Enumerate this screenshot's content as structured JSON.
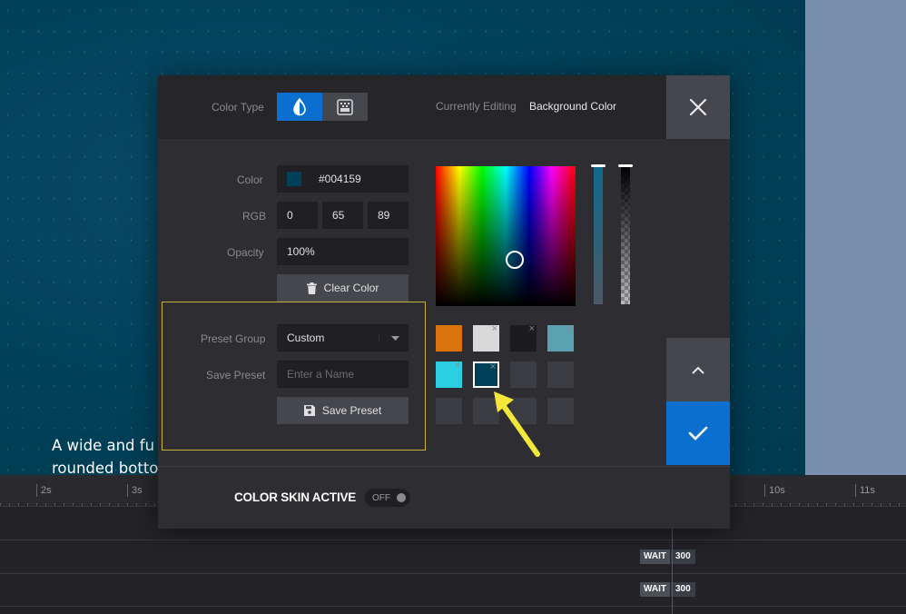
{
  "stage": {
    "text": "A wide and fu\nrounded botto"
  },
  "timeline": {
    "ticks": [
      "2s",
      "3s",
      "10s",
      "11s"
    ],
    "tracks": [
      {
        "wait_label": "WAIT",
        "wait_value": "300"
      },
      {
        "wait_label": "WAIT",
        "wait_value": "300"
      }
    ]
  },
  "modal": {
    "color_type_label": "Color Type",
    "currently_editing_label": "Currently Editing",
    "currently_editing_value": "Background Color",
    "color_label": "Color",
    "color_hex": "#004159",
    "rgb_label": "RGB",
    "rgb": {
      "r": "0",
      "g": "65",
      "b": "89"
    },
    "opacity_label": "Opacity",
    "opacity_value": "100%",
    "clear_color_label": "Clear Color",
    "preset_group_label": "Preset Group",
    "preset_group_value": "Custom",
    "save_preset_label": "Save Preset",
    "save_preset_placeholder": "Enter a Name",
    "save_preset_button": "Save Preset",
    "color_skin_label": "COLOR SKIN ACTIVE",
    "toggle_state": "OFF"
  },
  "colors": {
    "current": "#004159",
    "accent": "#0b6fcf",
    "preset_outline": "#c9b33a",
    "arrow": "#f5e63a"
  },
  "presets": [
    {
      "color": "#d9730c",
      "removable": false
    },
    {
      "color": "#d9d9d9",
      "removable": true
    },
    {
      "color": "#1c1c1e",
      "removable": true
    },
    {
      "color": "#5aa2b2",
      "removable": true
    },
    {
      "color": "#2ad0e2",
      "removable": true
    },
    {
      "color": "#004159",
      "removable": true,
      "selected": true
    },
    {
      "color": "#3b3d42",
      "removable": false
    },
    {
      "color": "#3b3d42",
      "removable": false
    },
    {
      "color": "#3b3d42",
      "removable": false
    },
    {
      "color": "#3b3d42",
      "removable": false
    },
    {
      "color": "#3b3d42",
      "removable": false
    },
    {
      "color": "#3b3d42",
      "removable": false
    }
  ],
  "icons": {
    "solid_type": "drop-icon",
    "gradient_type": "gradient-icon",
    "close": "close-icon",
    "clear": "trash-icon",
    "save": "floppy-icon",
    "collapse": "chevron-up-icon",
    "confirm": "check-icon"
  }
}
